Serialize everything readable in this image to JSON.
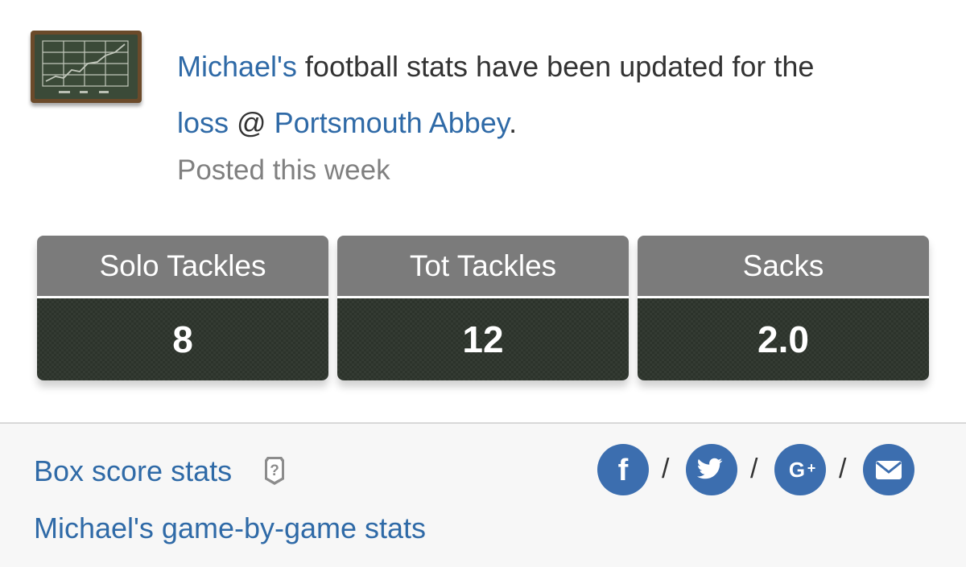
{
  "post": {
    "player_name": "Michael's",
    "text_mid": " football stats have been updated for the ",
    "result_link": "loss",
    "at_symbol": " @ ",
    "opponent_link": "Portsmouth Abbey",
    "period": ".",
    "posted": "Posted this week"
  },
  "stats": [
    {
      "label": "Solo Tackles",
      "value": "8"
    },
    {
      "label": "Tot Tackles",
      "value": "12"
    },
    {
      "label": "Sacks",
      "value": "2.0"
    }
  ],
  "footer": {
    "box_score_link": "Box score stats",
    "game_by_game_link": "Michael's game-by-game stats",
    "help_icon": "question-badge-icon",
    "share_separator": "/",
    "share_icons": [
      "facebook-icon",
      "twitter-icon",
      "google-plus-icon",
      "email-icon"
    ]
  },
  "colors": {
    "link": "#2f6aa7",
    "stat_header": "#7b7b7b",
    "stat_value_bg": "#2c332b",
    "share_circle": "#3c6eaf"
  }
}
